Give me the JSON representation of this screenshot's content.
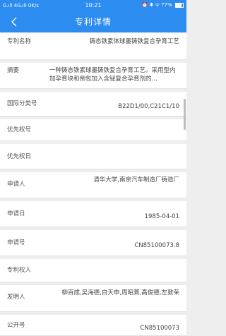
{
  "status": {
    "left": "G.ıll 4G.ıll 0K/s",
    "time": "10:21",
    "right": "⏰ ✱ ᯤ 77%",
    "battery_level": 0.77
  },
  "nav": {
    "title": "专利详情",
    "back_icon": "chevron-left-icon"
  },
  "rows": [
    {
      "label": "专利名称",
      "value": "铸态铁素体球墨铸铁复合孕育工艺"
    },
    {
      "label": "摘要",
      "value": "一种铸态铁素球墨铸铁复合孕育工艺。采用型内加孕育块和倒包加入含铋复合孕育剂的…"
    },
    {
      "label": "国际分类号",
      "value": "B22D1/00,C21C1/10"
    },
    {
      "label": "优先权号",
      "value": ""
    },
    {
      "label": "优先权日",
      "value": ""
    },
    {
      "label": "申请人",
      "value": "清华大学,南京汽车制造厂铸造厂"
    },
    {
      "label": "申请日",
      "value": "1985-04-01"
    },
    {
      "label": "申请号",
      "value": "CN85100073.8"
    },
    {
      "label": "专利权人",
      "value": ""
    },
    {
      "label": "发明人",
      "value": "柳百成,吴海德,白天申,周昭葺,高俊德,左敦荣"
    },
    {
      "label": "公开号",
      "value": "CN85100073"
    }
  ]
}
